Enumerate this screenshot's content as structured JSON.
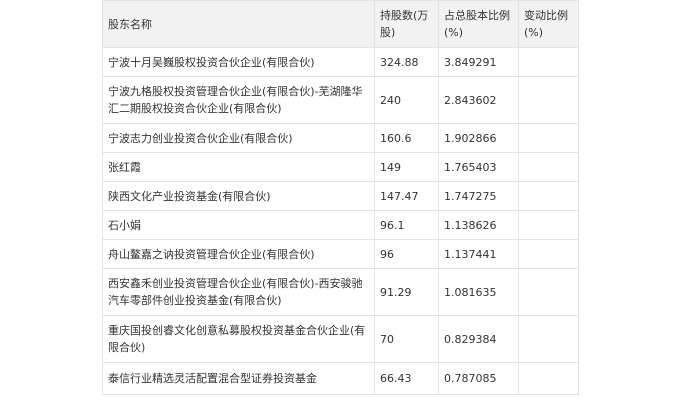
{
  "table": {
    "headers": {
      "name": "股东名称",
      "shares": "持股数(万股)",
      "pct": "占总股本比例(%)",
      "change": "变动比例(%)"
    },
    "rows": [
      {
        "name": "宁波十月吴巍股权投资合伙企业(有限合伙)",
        "shares": "324.88",
        "pct": "3.849291",
        "change": ""
      },
      {
        "name": "宁波九格股权投资管理合伙企业(有限合伙)-芜湖隆华汇二期股权投资合伙企业(有限合伙)",
        "shares": "240",
        "pct": "2.843602",
        "change": ""
      },
      {
        "name": "宁波志力创业投资合伙企业(有限合伙)",
        "shares": "160.6",
        "pct": "1.902866",
        "change": ""
      },
      {
        "name": "张红霞",
        "shares": "149",
        "pct": "1.765403",
        "change": ""
      },
      {
        "name": "陕西文化产业投资基金(有限合伙)",
        "shares": "147.47",
        "pct": "1.747275",
        "change": ""
      },
      {
        "name": "石小娟",
        "shares": "96.1",
        "pct": "1.138626",
        "change": ""
      },
      {
        "name": "舟山鳌嘉之讷投资管理合伙企业(有限合伙)",
        "shares": "96",
        "pct": "1.137441",
        "change": ""
      },
      {
        "name": "西安鑫禾创业投资管理合伙企业(有限合伙)-西安骏驰汽车零部件创业投资基金(有限合伙)",
        "shares": "91.29",
        "pct": "1.081635",
        "change": ""
      },
      {
        "name": "重庆国投创睿文化创意私募股权投资基金合伙企业(有限合伙)",
        "shares": "70",
        "pct": "0.829384",
        "change": ""
      },
      {
        "name": "泰信行业精选灵活配置混合型证券投资基金",
        "shares": "66.43",
        "pct": "0.787085",
        "change": ""
      }
    ]
  }
}
